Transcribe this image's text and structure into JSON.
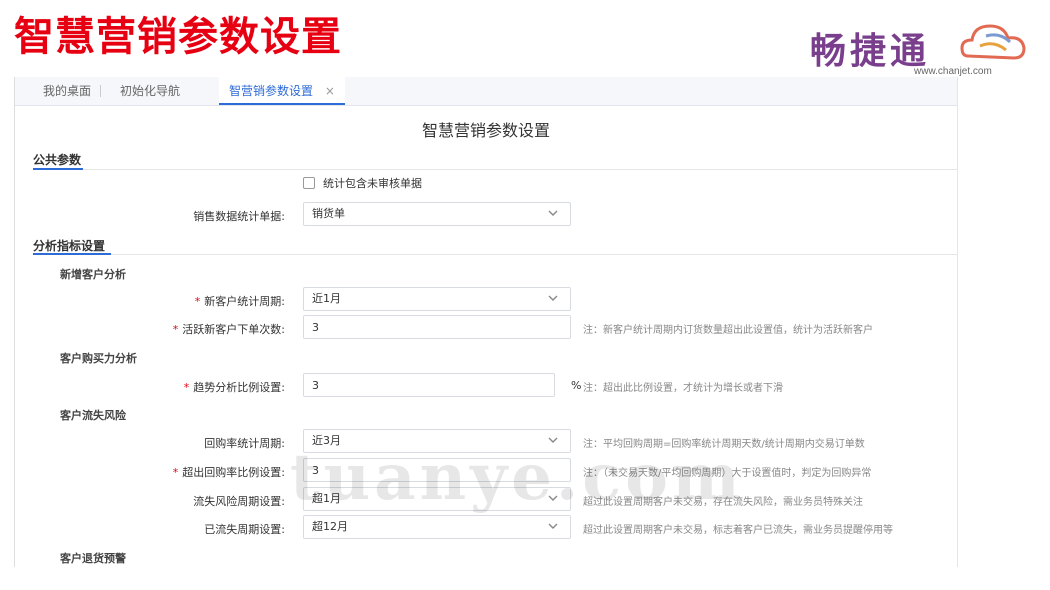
{
  "slide": {
    "title": "智慧营销参数设置"
  },
  "logo": {
    "text": "畅捷通",
    "url": "www.chanjet.com"
  },
  "tabs": [
    {
      "label": "我的桌面"
    },
    {
      "label": "初始化导航"
    },
    {
      "label": "智营销参数设置",
      "close": "×"
    }
  ],
  "page": {
    "title": "智慧营销参数设置"
  },
  "public_params": {
    "title": "公共参数",
    "checkbox_label": "统计包含未审核单据",
    "sales_stat": {
      "label": "销售数据统计单据:",
      "value": "销货单"
    }
  },
  "analysis": {
    "title": "分析指标设置",
    "new_customer": {
      "title": "新增客户分析",
      "period": {
        "label": "新客户统计周期:",
        "value": "近1月"
      },
      "orders": {
        "label": "活跃新客户下单次数:",
        "value": "3",
        "note": "注：新客户统计周期内订货数量超出此设置值，统计为活跃新客户"
      }
    },
    "purchase_power": {
      "title": "客户购买力分析",
      "trend": {
        "label": "趋势分析比例设置:",
        "value": "3",
        "unit": "%",
        "note": "注：超出此比例设置，才统计为增长或者下滑"
      }
    },
    "churn": {
      "title": "客户流失风险",
      "repurchase_period": {
        "label": "回购率统计周期:",
        "value": "近3月",
        "note": "注：平均回购周期=回购率统计周期天数/统计周期内交易订单数"
      },
      "exceed_ratio": {
        "label": "超出回购率比例设置:",
        "value": "3",
        "note": "注：（未交易天数/平均回购周期）大于设置值时，判定为回购异常"
      },
      "risk_period": {
        "label": "流失风险周期设置:",
        "value": "超1月",
        "note": "超过此设置周期客户未交易，存在流失风险，需业务员特殊关注"
      },
      "lost_period": {
        "label": "已流失周期设置:",
        "value": "超12月",
        "note": "超过此设置周期客户未交易，标志着客户已流失，需业务员提醒停用等"
      }
    },
    "return_warning": {
      "title": "客户退货预警"
    }
  },
  "watermark": "tuanye.com"
}
